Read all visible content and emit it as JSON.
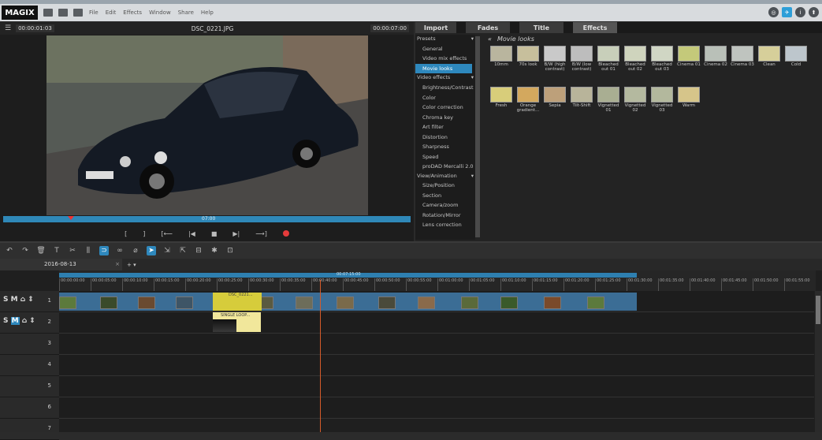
{
  "menubar": {
    "logo": "MAGIX",
    "items": [
      "File",
      "Edit",
      "Effects",
      "Window",
      "Share",
      "Help"
    ]
  },
  "preview": {
    "timecode_left": "00:00:01:03",
    "filename": "DSC_0221.JPG",
    "timecode_right": "00:00:07:00",
    "scrub_label": "07:00",
    "transport": [
      "[",
      "]",
      "[⟵",
      "|◀",
      "■",
      "▶|",
      "⟶]"
    ]
  },
  "panel": {
    "tabs": [
      "Import",
      "Fades",
      "Title",
      "Effects"
    ],
    "active_tab": "Effects",
    "tree": [
      {
        "cat": "Presets",
        "items": [
          "General",
          "Video mix effects",
          "Movie looks"
        ]
      },
      {
        "cat": "Video effects",
        "items": [
          "Brightness/Contrast",
          "Color",
          "Color correction",
          "Chroma key",
          "Art filter",
          "Distortion",
          "Sharpness",
          "Speed",
          "proDAD Mercalli 2.0"
        ]
      },
      {
        "cat": "View/Animation",
        "items": [
          "Size/Position",
          "Section",
          "Camera/zoom",
          "Rotation/Mirror",
          "Lens correction"
        ]
      }
    ],
    "selected_item": "Movie looks",
    "grid_title": "Movie looks",
    "back_label": "«",
    "looks": [
      "10mm",
      "70s look",
      "B/W (high contrast)",
      "B/W (low contrast)",
      "Bleached out 01",
      "Bleached out 02",
      "Bleached out 03",
      "Cinema 01",
      "Cinema 02",
      "Cinema 03",
      "Clean",
      "Cold",
      "Fresh",
      "Orange gradient...",
      "Sepia",
      "Tilt-Shift",
      "Vignetted 01",
      "Vignetted 02",
      "Vignetted 03",
      "Warm"
    ]
  },
  "timeline": {
    "project_tab": "2016-08-13",
    "close": "×",
    "add": "+ ▾",
    "range_label": "00:07:15:00",
    "ruler": [
      "00:00:00:00",
      "00:00:05:00",
      "00:00:10:00",
      "00:00:15:00",
      "00:00:20:00",
      "00:00:25:00",
      "00:00:30:00",
      "00:00:35:00",
      "00:00:40:00",
      "00:00:45:00",
      "00:00:50:00",
      "00:00:55:00",
      "00:01:00:00",
      "00:01:05:00",
      "00:01:10:00",
      "00:01:15:00",
      "00:01:20:00",
      "00:01:25:00",
      "00:01:30:00",
      "00:01:35:00",
      "00:01:40:00",
      "00:01:45:00",
      "00:01:50:00",
      "00:01:55:00"
    ],
    "tracks": [
      "1",
      "2",
      "3",
      "4",
      "5",
      "6",
      "7"
    ],
    "yellow_clip_label": "DSC_0221...",
    "title_clip_label": "SINGLE LOOP..."
  },
  "colors": {
    "accent": "#2e88bd",
    "clip": "#3b6d95",
    "highlight": "#d6cc3b",
    "cursor": "#d65b2a"
  }
}
